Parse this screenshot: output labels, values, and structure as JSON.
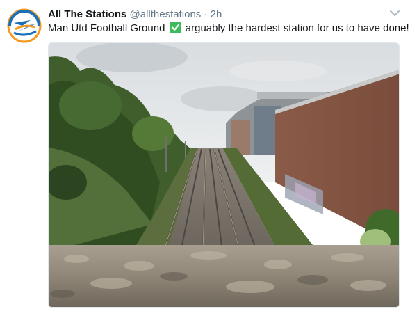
{
  "tweet": {
    "display_name": "All The Stations",
    "handle": "@allthestations",
    "separator": "·",
    "time": "2h",
    "text_before": "Man Utd Football Ground",
    "text_after": "arguably the hardest station for us to have done!"
  },
  "icons": {
    "avatar": "all-the-stations-logo",
    "check": "white-check-mark-emoji",
    "caret": "chevron-down-icon"
  },
  "colors": {
    "name": "#14171a",
    "secondary": "#657786",
    "check_green": "#3dba5c",
    "brand_blue": "#1b6fb7",
    "brand_orange": "#f39a1f"
  }
}
